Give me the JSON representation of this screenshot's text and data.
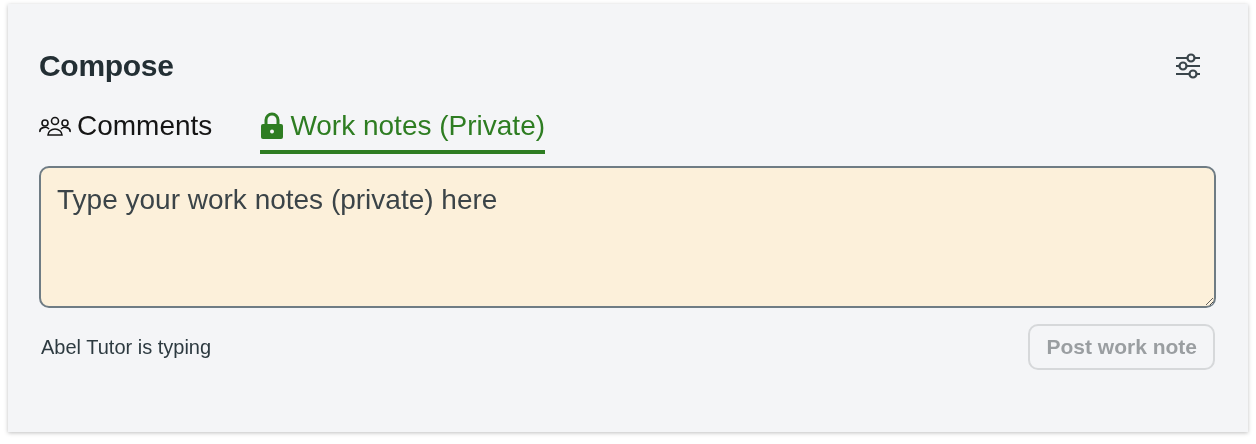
{
  "panel": {
    "title": "Compose"
  },
  "tabs": [
    {
      "label": "Comments",
      "kind": "people",
      "selected": false
    },
    {
      "label": "Work notes (Private)",
      "kind": "lock",
      "selected": true
    }
  ],
  "editor": {
    "placeholder": "Type your work notes (private) here"
  },
  "status": "Abel Tutor is typing",
  "post_button": {
    "label": "Post work note",
    "disabled": true
  }
}
